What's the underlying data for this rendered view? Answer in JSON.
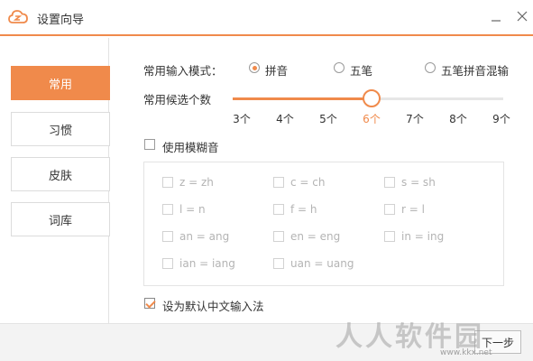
{
  "window": {
    "title": "设置向导",
    "accent": "#f08a4b"
  },
  "sidebar": {
    "items": [
      {
        "label": "常用",
        "active": true
      },
      {
        "label": "习惯",
        "active": false
      },
      {
        "label": "皮肤",
        "active": false
      },
      {
        "label": "词库",
        "active": false
      }
    ]
  },
  "input_mode": {
    "label": "常用输入模式：",
    "options": [
      {
        "label": "拼音",
        "selected": true
      },
      {
        "label": "五笔",
        "selected": false
      },
      {
        "label": "五笔拼音混输",
        "selected": false
      }
    ]
  },
  "candidates": {
    "label": "常用候选个数",
    "ticks": [
      "3个",
      "4个",
      "5个",
      "6个",
      "7个",
      "8个",
      "9个"
    ],
    "selected_index": 3
  },
  "fuzzy": {
    "label": "使用模糊音",
    "checked": false,
    "options": [
      [
        "z = zh",
        "c = ch",
        "s = sh"
      ],
      [
        "l = n",
        "f = h",
        "r = l"
      ],
      [
        "an = ang",
        "en = eng",
        "in = ing"
      ],
      [
        "ian = iang",
        "uan = uang"
      ]
    ]
  },
  "default_ime": {
    "label": "设为默认中文输入法",
    "checked": true
  },
  "footer": {
    "next_label": "下一步"
  },
  "watermark": {
    "text": "人人软件园",
    "url": "www.kkx.net"
  }
}
